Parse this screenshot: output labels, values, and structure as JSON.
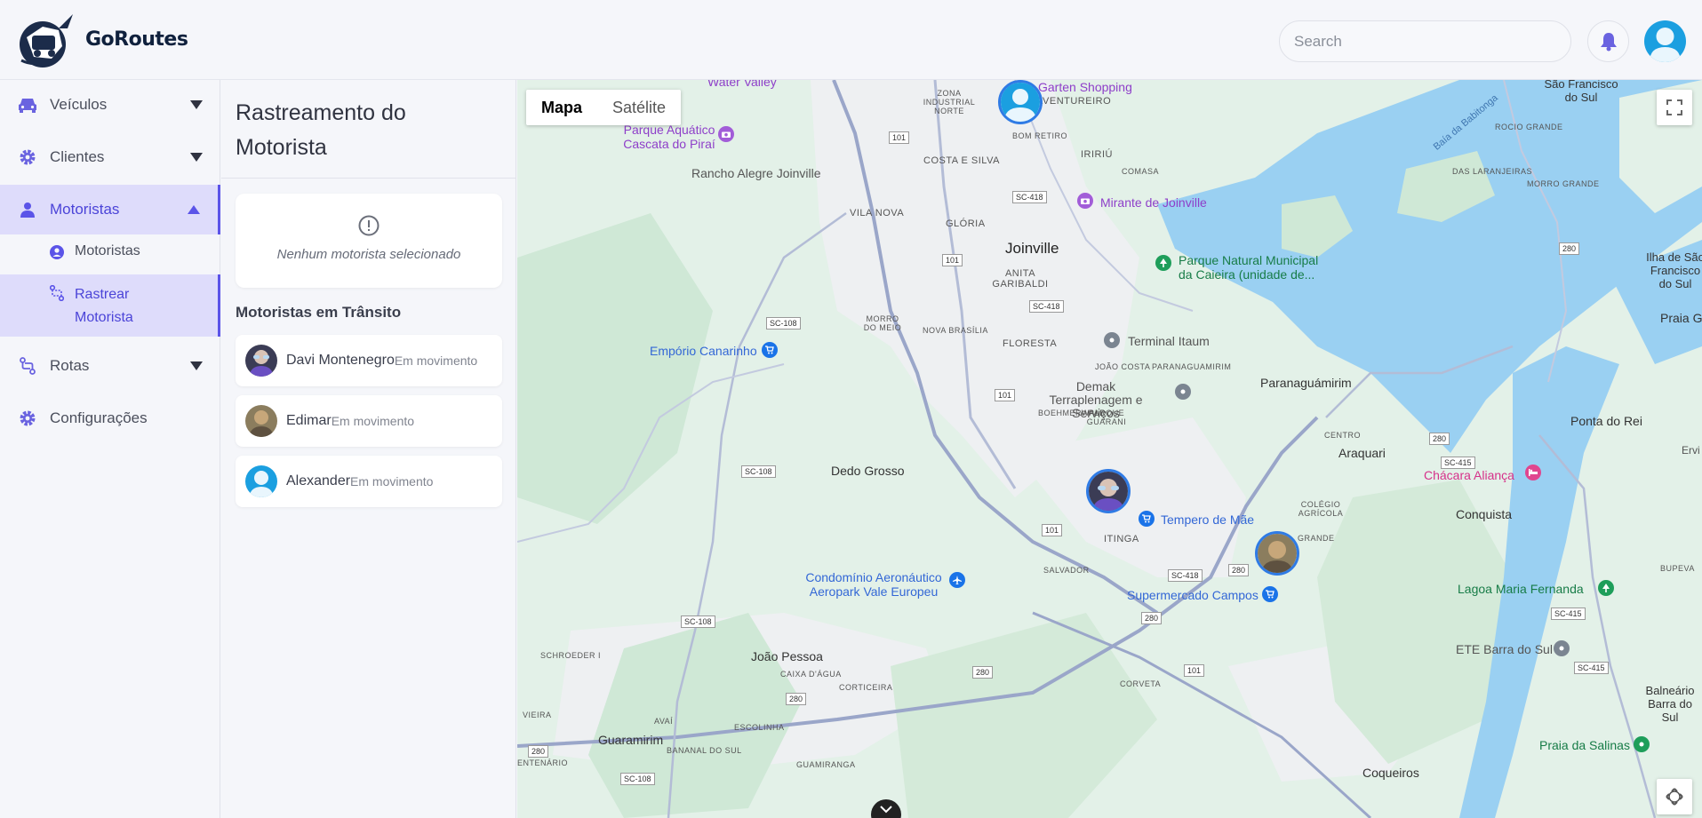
{
  "app": {
    "brand": "GoRoutes"
  },
  "header": {
    "search_placeholder": "Search"
  },
  "sidebar": {
    "items": [
      {
        "label": "Veículos"
      },
      {
        "label": "Clientes"
      },
      {
        "label": "Motoristas"
      },
      {
        "label": "Rotas"
      },
      {
        "label": "Configurações"
      }
    ],
    "sub_items": [
      {
        "label": "Motoristas"
      },
      {
        "label": "Rastrear Motorista"
      }
    ]
  },
  "panel": {
    "title": "Rastreamento do Motorista",
    "empty_text": "Nenhum motorista selecionado",
    "section_title": "Motoristas em Trânsito",
    "drivers": [
      {
        "name": "Davi Montenegro",
        "status": "Em movimento"
      },
      {
        "name": "Edimar",
        "status": "Em movimento"
      },
      {
        "name": "Alexander",
        "status": "Em movimento"
      }
    ]
  },
  "map": {
    "type_buttons": [
      "Mapa",
      "Satélite"
    ],
    "selected_type": "Mapa",
    "labels": {
      "joinville": "Joinville",
      "dedo_grosso": "Dedo Grosso",
      "joao_pessoa": "João Pessoa",
      "guaramirim": "Guaramirim",
      "paranaguamirim": "Paranaguámirim",
      "araquari": "Araquari",
      "conquista": "Conquista",
      "coqueiros": "Coqueiros",
      "ponta_do_rei": "Ponta do Rei",
      "praia_gra": "Praia Gra",
      "sao_francisco": "São Francisco do Sul",
      "ilha": "Ilha de São Francisco do Sul",
      "balneario": "Balneário Barra do Sul",
      "vila_nova": "VILA NOVA",
      "gloria": "GLÓRIA",
      "costa_e_silva": "COSTA E SILVA",
      "iririu": "IRIRIÚ",
      "aventureiro": "AVENTUREIRO",
      "bom_retiro": "BOM RETIRO",
      "anita": "ANITA GARIBALDI",
      "floresta": "FLORESTA",
      "nova_brasilia": "NOVA BRASÍLIA",
      "morro_do_meio": "MORRO DO MEIO",
      "zona_industrial": "ZONA INDUSTRIAL NORTE",
      "comasa": "COMASA",
      "joao_costa": "JOÃO COSTA",
      "boehmerwald": "BOEHMERWALD",
      "parque_guarani": "PARQUE GUARANI",
      "itinga": "ITINGA",
      "salvador": "SALVADOR",
      "centro": "CENTRO",
      "colegio_agricola": "COLÉGIO AGRÍCOLA",
      "grande": "GRANDE",
      "das_laranjeiras": "DAS LARANJEIRAS",
      "morro_grande": "MORRO GRANDE",
      "rocio_grande": "ROCIO GRANDE",
      "bupeva": "BUPEVA",
      "ervi": "Ervi",
      "schroeder": "SCHROEDER I",
      "caixa_dagua": "CAIXA D'ÁGUA",
      "corticeira": "CORTICEIRA",
      "corveta": "CORVETA",
      "vieira": "VIEIRA",
      "avai": "AVAÍ",
      "escolinha": "ESCOLINHA",
      "bananal": "BANANAL DO SUL",
      "guamiranga": "GUAMIRANGA",
      "entenario": "ENTENÁRIO",
      "paranaguamirim_small": "PARANAGUAMIRIM",
      "baia": "Baía da Babitonga"
    },
    "pois": {
      "emporio": "Empório Canarinho",
      "rancho": "Rancho Alegre Joinville",
      "parque_aquatico": "Parque Aquático Cascata do Piraí",
      "water_valley": "Water Valley",
      "garten": "Garten Shopping",
      "mirante": "Mirante de Joinville",
      "parque_natural": "Parque Natural Municipal da Caieira (unidade de...",
      "terminal": "Terminal Itaum",
      "demak": "Demak Terraplenagem e Serviços",
      "tempero": "Tempero de Mãe",
      "supermercado": "Supermercado Campos",
      "condominio": "Condomínio Aeronáutico Aeropark Vale Europeu",
      "chacara": "Chácara Aliança",
      "lagoa": "Lagoa Maria Fernanda",
      "ete": "ETE Barra do Sul",
      "praia_salinas": "Praia da Salinas"
    },
    "roads": {
      "sc108": "SC-108",
      "sc418": "SC-418",
      "sc415": "SC-415",
      "r101": "101",
      "r280": "280"
    }
  }
}
